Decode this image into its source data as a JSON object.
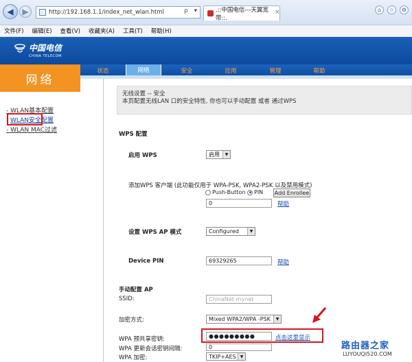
{
  "browser": {
    "address": "http://192.168.1.1/index_net_wlan.html",
    "address_tools": "ρ ▾ ⊠ C ×",
    "tab_title": ".::中国电信---天翼宽带::.",
    "tab_close": "×",
    "menu": [
      "文件(F)",
      "编辑(E)",
      "查看(V)",
      "收藏夹(A)",
      "工具(T)",
      "帮助(H)"
    ]
  },
  "brand": {
    "name_cn": "中国电信",
    "name_en": "CHINA TELECOM"
  },
  "nav": {
    "section_title": "网络",
    "tabs": [
      {
        "label": "状态",
        "active": false
      },
      {
        "label": "网络",
        "active": true
      },
      {
        "label": "安全",
        "active": false
      },
      {
        "label": "应用",
        "active": false
      },
      {
        "label": "管理",
        "active": false
      },
      {
        "label": "帮助",
        "active": false
      }
    ]
  },
  "sidebar": {
    "items": [
      {
        "label": "- WLAN基本配置"
      },
      {
        "label": "WLAN安全配置"
      },
      {
        "label": "- WLAN MAC过滤"
      }
    ]
  },
  "info": {
    "line1": "无线设置 -- 安全",
    "line2": "本页配置无线LAN 口的安全特性, 你也可以手动配置 或者 通过WPS"
  },
  "wps": {
    "section_title": "WPS 配置",
    "enable_label": "启用 WPS",
    "enable_value": "启用",
    "add_client_label": "添加WPS 客户端 (此功能仅用于 WPA-PSK, WPA2-PSK 以及禁用模式)",
    "radio_push": "Push-Button",
    "radio_pin": "PIN",
    "add_enrollee_button": "Add Enrollee",
    "enrollee_input": "0",
    "help_link": "帮助",
    "ap_mode_label": "设置 WPS AP 模式",
    "ap_mode_value": "Configured",
    "device_pin_label": "Device PIN",
    "device_pin_value": "69329265"
  },
  "manual": {
    "section_title": "手动配置 AP",
    "ssid_label": "SSID:",
    "ssid_placeholder": "ChinaNet-mynet",
    "encryption_label": "加密方式:",
    "encryption_value": "Mixed WPA2/WPA -PSK",
    "psk_label": "WPA 预共享密钥:",
    "psk_value": "●●●●●●●●●",
    "psk_show_link": "点击这里显示",
    "rekey_label": "WPA 更新会话密钥间隔:",
    "rekey_value": "0",
    "wpa_enc_label": "WPA 加密:",
    "wpa_enc_value": "TKIP+AES"
  },
  "watermark": {
    "title": "路由器之家",
    "url": "LUYOUQI520.COM"
  },
  "colors": {
    "brand_blue": "#0c4a9e",
    "nav_orange": "#f29322",
    "active_tab": "#6bb1e8",
    "highlight_red": "#d6151d"
  }
}
